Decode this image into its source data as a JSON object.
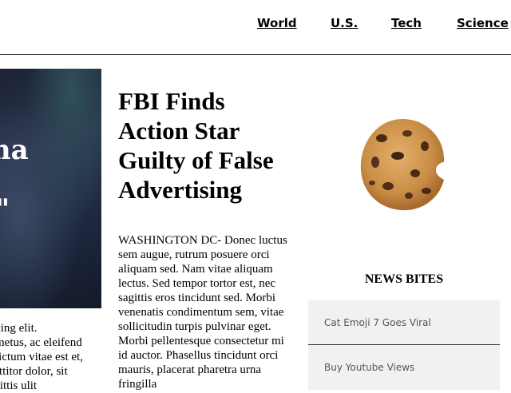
{
  "nav": {
    "items": [
      {
        "label": "World"
      },
      {
        "label": "U.S."
      },
      {
        "label": "Tech"
      },
      {
        "label": "Science"
      }
    ]
  },
  "hero": {
    "quote": "Tuna\nrt.\nny.\""
  },
  "left_column": {
    "lines": [
      "cing elit.",
      "metus, ac eleifend",
      "lictum vitae est et,",
      "rttitor dolor, sit",
      "sittis ulit"
    ]
  },
  "main_article": {
    "headline": "FBI Finds Action Star Guilty of False Advertising",
    "body": "WASHINGTON DC- Donec luctus sem augue, rutrum posuere orci aliquam sed. Nam vitae aliquam lectus. Sed tempor tortor est, nec sagittis eros tincidunt sed. Morbi venenatis condimentum sem, vitae sollicitudin turpis pulvinar eget. Morbi pellentesque consectetur mi id auctor. Phasellus tincidunt orci mauris, placerat pharetra urna fringilla"
  },
  "sidebar": {
    "title": "NEWS BITES",
    "bites": [
      {
        "label": "Cat Emoji 7 Goes Viral"
      },
      {
        "label": "Buy Youtube Views"
      }
    ]
  }
}
